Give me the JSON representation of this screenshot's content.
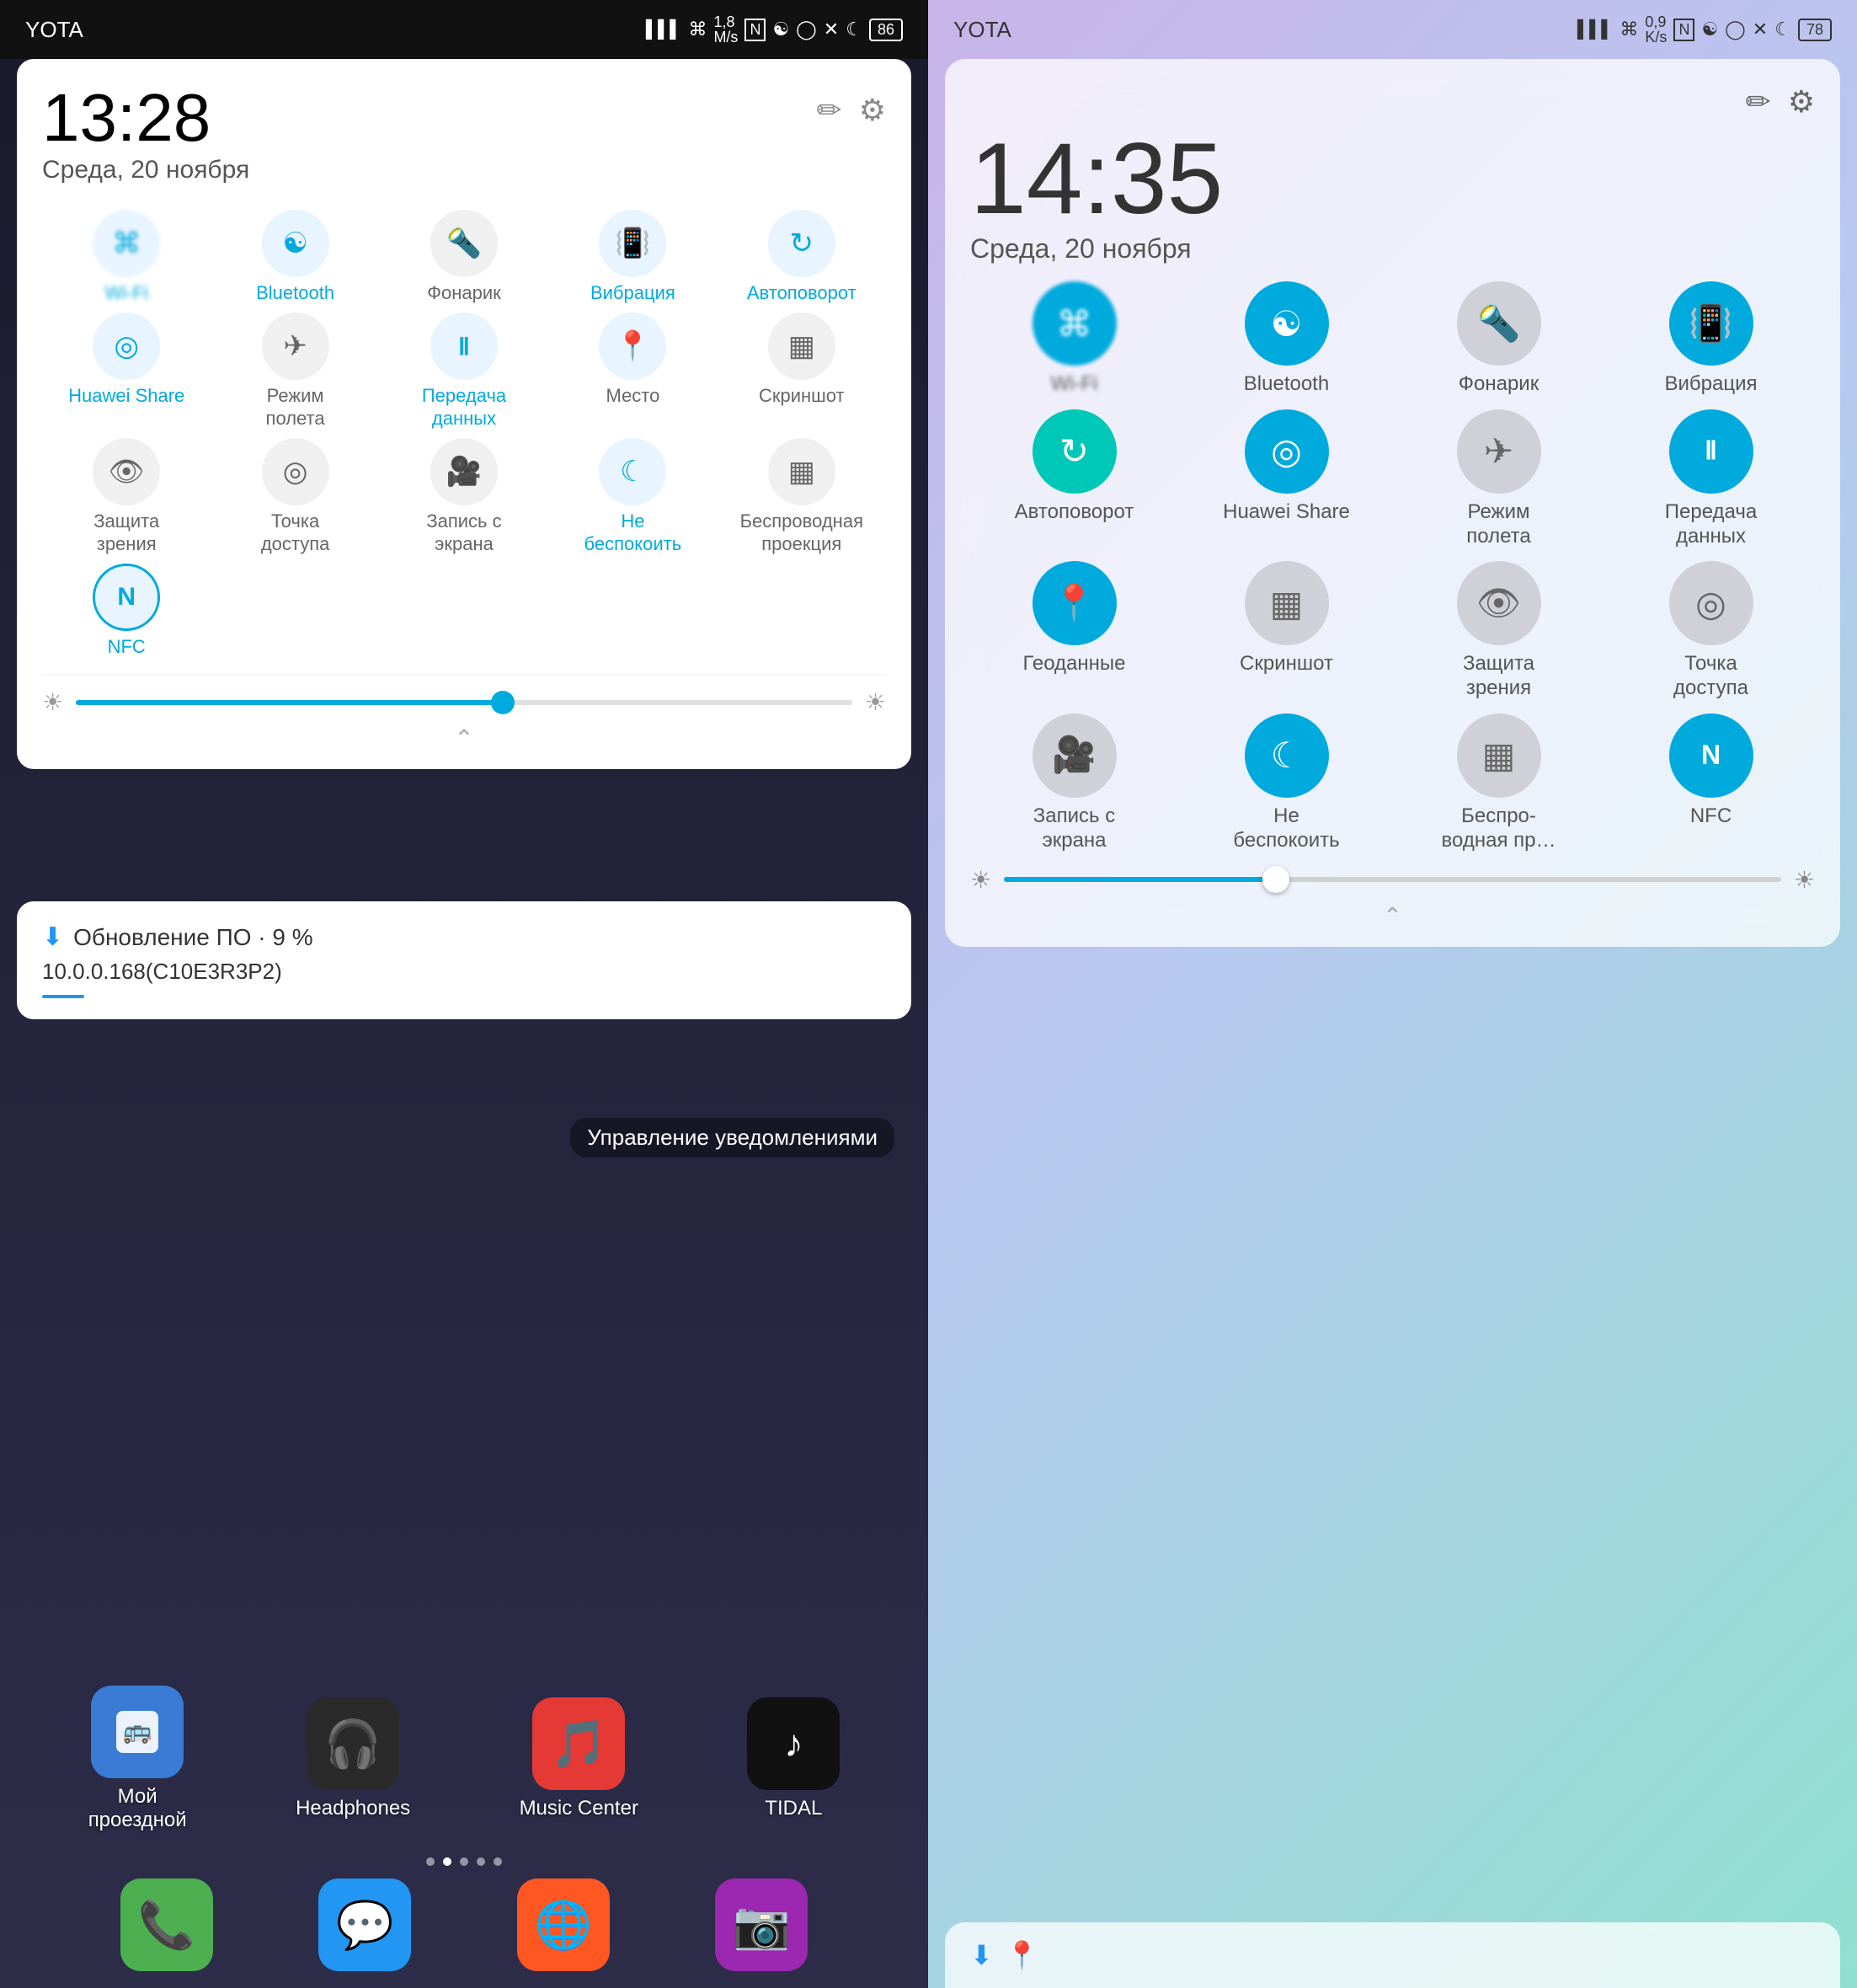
{
  "left": {
    "statusBar": {
      "carrier": "YOTA",
      "signal": "▌▌▌",
      "wifi": "WiFi",
      "speed": "1,8\nM/s",
      "battery": "86",
      "icons": "🔔 ✕ 🌙 🔋"
    },
    "time": "13:28",
    "date": "Среда, 20 ноября",
    "editIcon": "✏",
    "settingsIcon": "⚙",
    "toggles": [
      {
        "icon": "📶",
        "label": "Wi-Fi",
        "active": true,
        "blurred": true
      },
      {
        "icon": "✳",
        "label": "Bluetooth",
        "active": true,
        "labelActive": true
      },
      {
        "icon": "🔦",
        "label": "Фонарик",
        "active": false
      },
      {
        "icon": "📳",
        "label": "Вибрация",
        "active": true,
        "labelActive": true
      },
      {
        "icon": "⟳",
        "label": "Автоповорот",
        "active": true,
        "labelActive": true
      },
      {
        "icon": "◎",
        "label": "Huawei Share",
        "active": true,
        "labelActive": true
      },
      {
        "icon": "✈",
        "label": "Режим\nполета",
        "active": false
      },
      {
        "icon": "⑪",
        "label": "Передача\nданных",
        "active": true,
        "labelActive": true
      },
      {
        "icon": "📍",
        "label": "Место",
        "active": true,
        "labelActive": false
      },
      {
        "icon": "⬚",
        "label": "Скриншот",
        "active": false
      },
      {
        "icon": "👁",
        "label": "Защита\nзрения",
        "active": false
      },
      {
        "icon": "◎",
        "label": "Точка\nдоступа",
        "active": false
      },
      {
        "icon": "🎬",
        "label": "Запись с\nэкрана",
        "active": false
      },
      {
        "icon": "🌙",
        "label": "Не\nбеспокоить",
        "active": true,
        "labelActive": true
      },
      {
        "icon": "⬚",
        "label": "Беспроводная\nпроекция",
        "active": false
      },
      {
        "icon": "N",
        "label": "NFC",
        "active": true,
        "labelActive": true
      }
    ],
    "brightness": 55,
    "notification": {
      "icon": "⬇",
      "title": "Обновление ПО · 9 %",
      "subtitle": "10.0.0.168(C10E3R3P2)"
    },
    "apps": [
      {
        "icon": "🚌",
        "label": "Мой\nпроездной",
        "color": "#3a7bd5"
      },
      {
        "icon": "🎧",
        "label": "Headphones",
        "color": "#333"
      },
      {
        "icon": "🎵",
        "label": "Music Center",
        "color": "#e53935"
      },
      {
        "icon": "♪",
        "label": "TIDAL",
        "color": "#000"
      }
    ],
    "notifManage": "Управление уведомлениями",
    "dock": [
      {
        "icon": "📞",
        "color": "#4CAF50"
      },
      {
        "icon": "💬",
        "color": "#2196F3"
      },
      {
        "icon": "🌐",
        "color": "#FF5722"
      },
      {
        "icon": "📷",
        "color": "#9C27B0"
      }
    ]
  },
  "right": {
    "statusBar": {
      "carrier": "YOTA",
      "speed": "0,9\nK/s",
      "battery": "78"
    },
    "time": "14:35",
    "date": "Среда, 20 ноября",
    "editIcon": "✏",
    "settingsIcon": "⚙",
    "toggles": [
      {
        "icon": "📶",
        "label": "Wi-Fi",
        "active": true
      },
      {
        "icon": "✳",
        "label": "Bluetooth",
        "active": true
      },
      {
        "icon": "🔦",
        "label": "Фонарик",
        "active": false
      },
      {
        "icon": "📳",
        "label": "Вибрация",
        "active": true
      },
      {
        "icon": "⟳",
        "label": "Автоповорот",
        "active": true,
        "teal": true
      },
      {
        "icon": "◎",
        "label": "Huawei Share",
        "active": true
      },
      {
        "icon": "✈",
        "label": "Режим\nполета",
        "active": false
      },
      {
        "icon": "⑪",
        "label": "Передача\nданных",
        "active": true
      },
      {
        "icon": "📍",
        "label": "Геоданные",
        "active": true
      },
      {
        "icon": "⬚",
        "label": "Скриншот",
        "active": false
      },
      {
        "icon": "👁",
        "label": "Защита\nзрения",
        "active": false
      },
      {
        "icon": "◎",
        "label": "Точка\nдоступа",
        "active": false
      },
      {
        "icon": "🎬",
        "label": "Запись с\nэкрана",
        "active": false
      },
      {
        "icon": "🌙",
        "label": "Не\nбеспокоить",
        "active": true
      },
      {
        "icon": "⬚",
        "label": "Беспро-\nводная пр…",
        "active": false
      },
      {
        "icon": "N",
        "label": "NFC",
        "active": true
      }
    ],
    "brightness": 35,
    "bottomNotif": {
      "downloadIcon": "⬇",
      "pinIcon": "📍"
    }
  }
}
